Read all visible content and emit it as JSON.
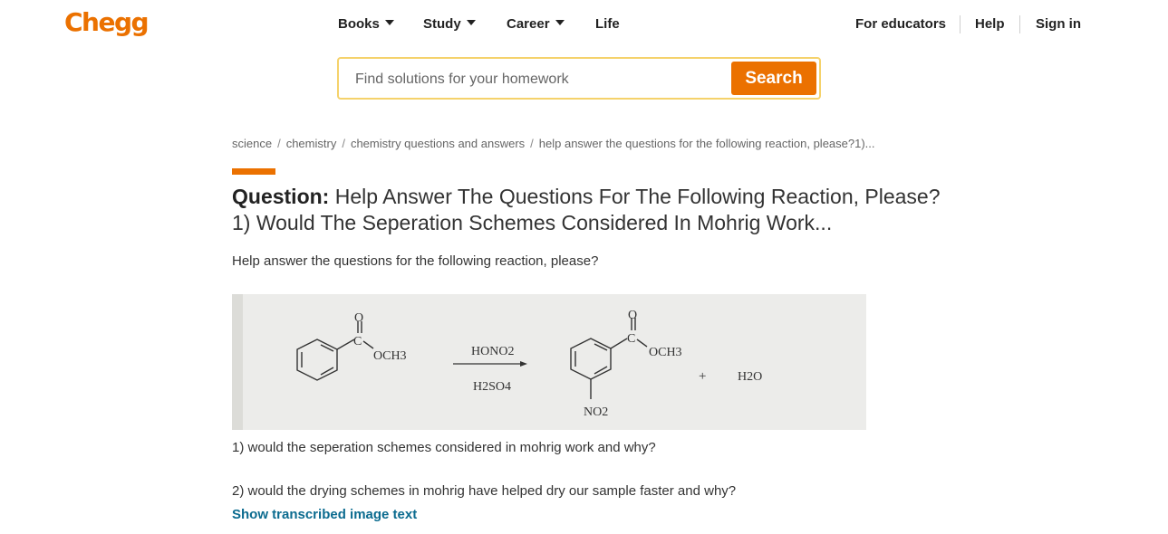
{
  "header": {
    "logo": "Chegg",
    "nav": [
      {
        "label": "Books",
        "has_dropdown": true
      },
      {
        "label": "Study",
        "has_dropdown": true
      },
      {
        "label": "Career",
        "has_dropdown": true
      },
      {
        "label": "Life",
        "has_dropdown": false
      }
    ],
    "right_links": [
      "For educators",
      "Help",
      "Sign in"
    ]
  },
  "search": {
    "placeholder": "Find solutions for your homework",
    "value": "",
    "button_label": "Search"
  },
  "breadcrumb": [
    "science",
    "chemistry",
    "chemistry questions and answers",
    "help answer the questions for the following reaction, please?1)..."
  ],
  "question": {
    "label": "Question:",
    "title": " Help Answer The Questions For The Following Reaction, Please?1) Would The Seperation Schemes Considered In Mohrig Work...",
    "intro": "Help answer the questions for the following reaction, please?",
    "figure": {
      "reactant_group": "OCH3",
      "reactant_carbonyl": "C",
      "reactant_oxygen": "O",
      "reagent_top": "HONO2",
      "reagent_bottom": "H2SO4",
      "product_group": "OCH3",
      "product_carbonyl": "C",
      "product_oxygen": "O",
      "product_substituent": "NO2",
      "plus": "+",
      "byproduct": "H2O"
    },
    "q1": "1) would the seperation schemes considered in mohrig work and why?",
    "q2": "2) would the drying schemes in mohrig have helped dry our sample faster and why?",
    "show_transcribed": "Show transcribed image text"
  },
  "colors": {
    "brand": "#eb7100",
    "link": "#0b6b8f",
    "search_border": "#f5d26b"
  }
}
